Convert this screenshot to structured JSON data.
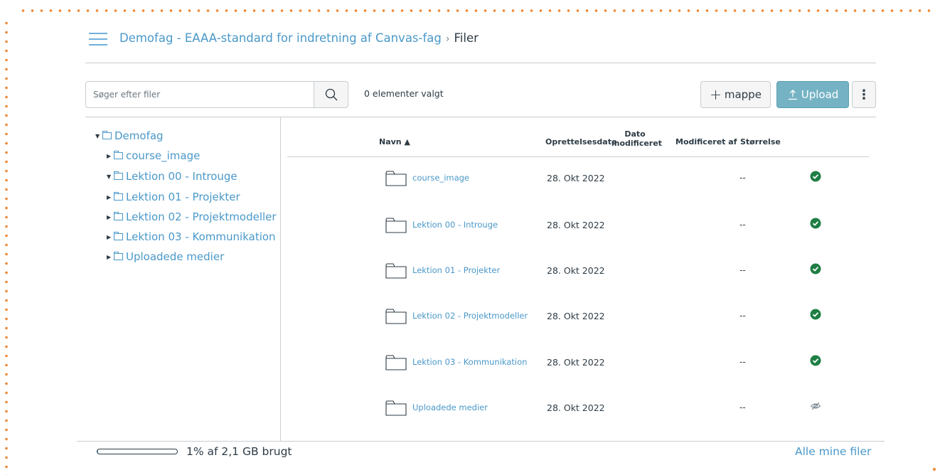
{
  "colors": {
    "accent": "#4a98c9",
    "border_dots": "#ef8732",
    "published": "#1e7e43",
    "upload_button": "#75b3c4"
  },
  "breadcrumb": {
    "course": "Demofag - EAAA-standard for indretning af Canvas-fag",
    "separator": "›",
    "current": "Filer"
  },
  "search": {
    "placeholder": "Søger efter filer",
    "value": ""
  },
  "toolbar": {
    "selected_count": "0 elementer valgt",
    "add_folder_label": "mappe",
    "upload_label": "Upload",
    "more_label": "⋮"
  },
  "tree": {
    "root": "Demofag",
    "items": [
      {
        "label": "course_image",
        "expanded": false
      },
      {
        "label": "Lektion 00 - Introuge",
        "expanded": true
      },
      {
        "label": "Lektion 01 - Projekter",
        "expanded": false
      },
      {
        "label": "Lektion 02 - Projektmodeller",
        "expanded": false
      },
      {
        "label": "Lektion 03 - Kommunikation",
        "expanded": false
      },
      {
        "label": "Uploadede medier",
        "expanded": false
      }
    ]
  },
  "table": {
    "headers": {
      "name": "Navn ▲",
      "created": "Oprettelsesdato",
      "modified_line1": "Dato",
      "modified_line2": "modificeret",
      "modified_by": "Modificeret af",
      "size": "Størrelse"
    },
    "rows": [
      {
        "name": "course_image",
        "created": "28. Okt 2022",
        "size": "--",
        "status": "published"
      },
      {
        "name": "Lektion 00 - Introuge",
        "created": "28. Okt 2022",
        "size": "--",
        "status": "published"
      },
      {
        "name": "Lektion 01 - Projekter",
        "created": "28. Okt 2022",
        "size": "--",
        "status": "published"
      },
      {
        "name": "Lektion 02 - Projektmodeller",
        "created": "28. Okt 2022",
        "size": "--",
        "status": "published"
      },
      {
        "name": "Lektion 03 - Kommunikation",
        "created": "28. Okt 2022",
        "size": "--",
        "status": "published"
      },
      {
        "name": "Uploadede medier",
        "created": "28. Okt 2022",
        "size": "--",
        "status": "hidden"
      }
    ]
  },
  "footer": {
    "quota_percent": 1,
    "quota_text": "1% af 2,1 GB brugt",
    "all_files_link": "Alle mine filer"
  }
}
